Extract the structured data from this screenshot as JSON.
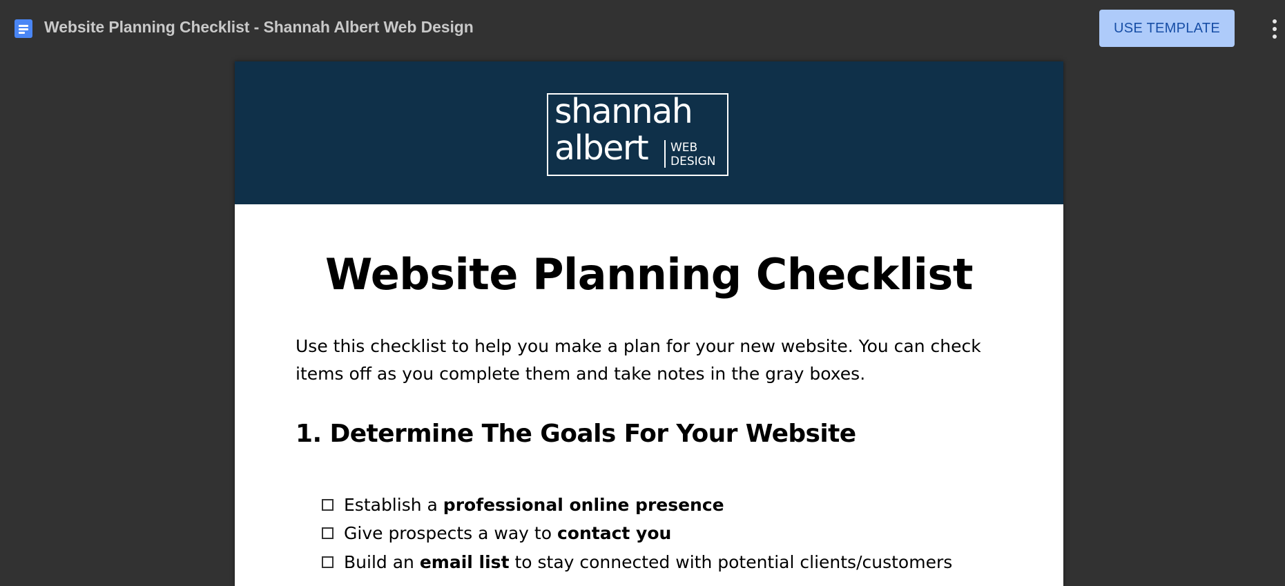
{
  "app_bar": {
    "doc_title": "Website Planning Checklist - Shannah Albert Web Design",
    "use_template_label": "USE TEMPLATE",
    "doc_icon": "google-docs-icon",
    "more_icon": "more-vert-icon"
  },
  "colors": {
    "app_bar_bg": "#323232",
    "button_bg": "#aecbfa",
    "button_text": "#174ea6",
    "banner_bg": "#0f3049",
    "doc_icon": "#4a86f5"
  },
  "document": {
    "logo": {
      "line1": "shannah",
      "line2": "albert",
      "tag1": "WEB",
      "tag2": "DESIGN"
    },
    "title": "Website Planning Checklist",
    "intro_line1": "Use this checklist to help you make a plan for your new website.  You can check",
    "intro_line2": "items off as you complete them and take notes in the gray boxes.",
    "section1_heading": "1.  Determine The Goals For Your Website",
    "items": [
      {
        "pre": "Establish a ",
        "bold": "professional online presence",
        "post": ""
      },
      {
        "pre": "Give prospects a way to ",
        "bold": "contact you",
        "post": ""
      },
      {
        "pre": "Build an ",
        "bold": "email list",
        "post": " to stay connected with potential clients/customers"
      }
    ]
  }
}
